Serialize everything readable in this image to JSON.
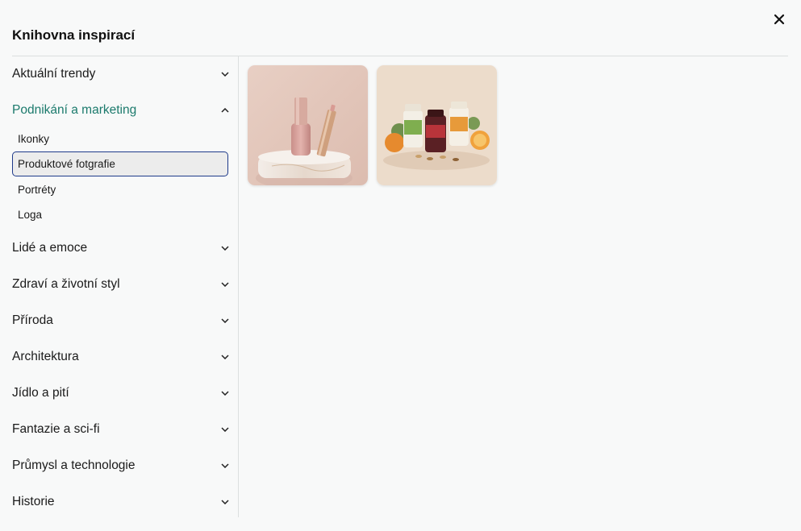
{
  "modal": {
    "title": "Knihovna inspirací",
    "close_icon": "close-icon"
  },
  "categories": [
    {
      "label": "Aktuální trendy",
      "expanded": false
    },
    {
      "label": "Podnikání a marketing",
      "expanded": true,
      "subitems": [
        "Ikonky",
        "Produktové fotgrafie",
        "Portréty",
        "Loga"
      ],
      "selected_subitem": "Produktové fotgrafie"
    },
    {
      "label": "Lidé a emoce",
      "expanded": false
    },
    {
      "label": "Zdraví a životní styl",
      "expanded": false
    },
    {
      "label": "Příroda",
      "expanded": false
    },
    {
      "label": "Architektura",
      "expanded": false
    },
    {
      "label": "Jídlo a pití",
      "expanded": false
    },
    {
      "label": "Fantazie a sci-fi",
      "expanded": false
    },
    {
      "label": "Průmysl a technologie",
      "expanded": false
    },
    {
      "label": "Historie",
      "expanded": false
    }
  ],
  "thumbnails": [
    {
      "name": "nail-polish-photo"
    },
    {
      "name": "supplement-bottles-photo"
    }
  ],
  "colors": {
    "accent": "#1b7a6c",
    "selected_border": "#1e3a8a",
    "selected_bg": "#ececec"
  }
}
